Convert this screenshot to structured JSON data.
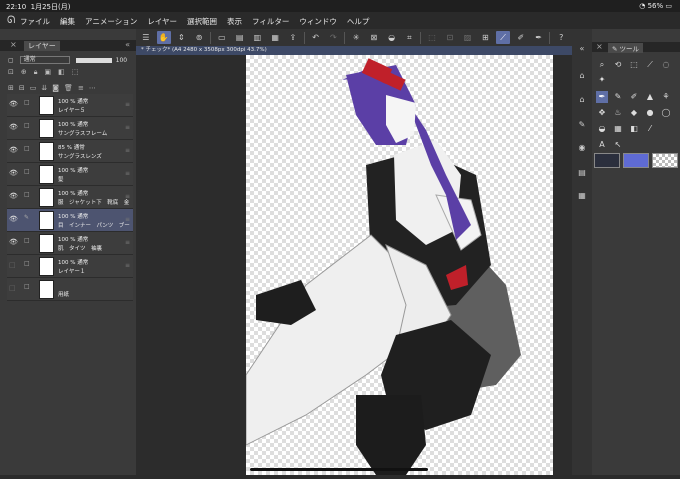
{
  "status": {
    "time": "22:10",
    "date": "1月25日(月)",
    "battery": "56%"
  },
  "menu": {
    "items": [
      "ファイル",
      "編集",
      "アニメーション",
      "レイヤー",
      "選択範囲",
      "表示",
      "フィルター",
      "ウィンドウ",
      "ヘルプ"
    ]
  },
  "layer_panel": {
    "title": "レイヤー",
    "blend_mode": "通常",
    "opacity": "100",
    "layers": [
      {
        "line1": "100 % 通常",
        "line2": "レイヤー５",
        "selected": false
      },
      {
        "line1": "100 % 通常",
        "line2": "サングラスフレーム",
        "selected": false
      },
      {
        "line1": "85 % 通常",
        "line2": "サングラスレンズ",
        "selected": false
      },
      {
        "line1": "100 % 通常",
        "line2": "髪",
        "selected": false
      },
      {
        "line1": "100 % 通常",
        "line2": "服　ジャケット下　靴底　金",
        "selected": false
      },
      {
        "line1": "100 % 通常",
        "line2": "目　インナー　パンツ　ブー",
        "selected": true
      },
      {
        "line1": "100 % 通常",
        "line2": "肌　タイツ　袖裏",
        "selected": false
      },
      {
        "line1": "100 % 通常",
        "line2": "レイヤー１",
        "selected": false
      },
      {
        "line1": "",
        "line2": "用紙",
        "selected": false
      }
    ]
  },
  "document": {
    "tab": "* チェック* (A4 2480 x 3508px 300dpi 43.7%)"
  },
  "tool_panel": {
    "title": "ツール"
  },
  "colors": {
    "main": "#2b2f3d",
    "sub": "#5f6bd4",
    "accent": "#5f6fa6"
  }
}
